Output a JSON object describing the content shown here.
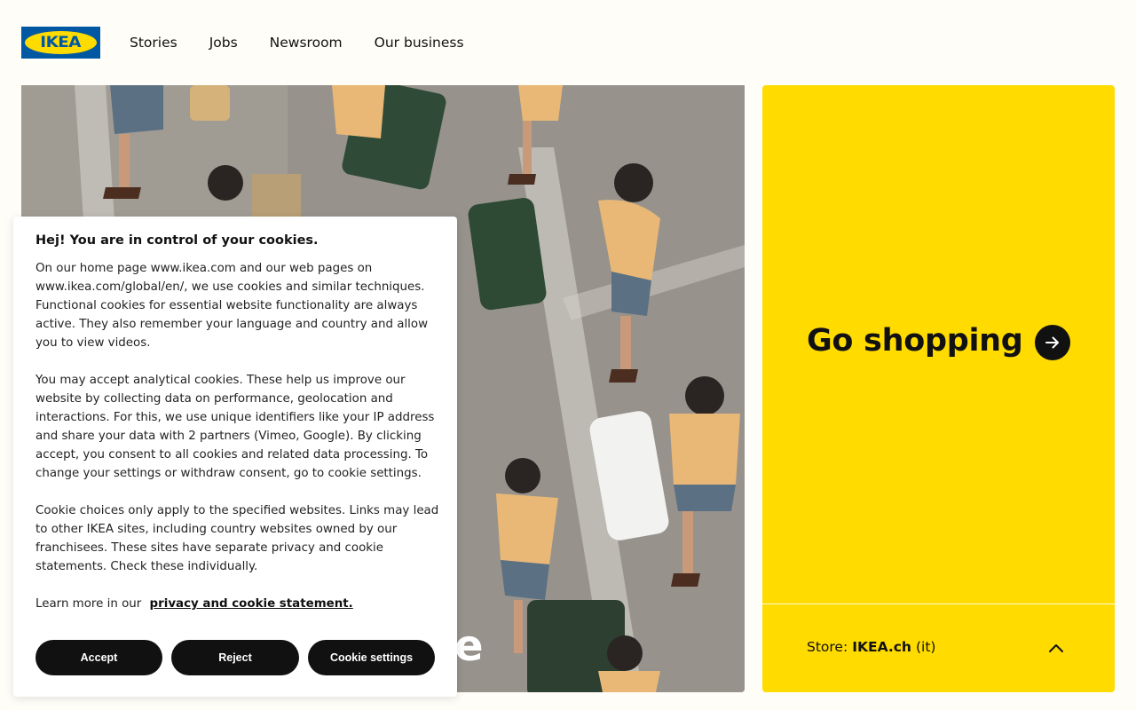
{
  "header": {
    "logo_text": "IKEA",
    "nav": [
      "Stories",
      "Jobs",
      "Newsroom",
      "Our business"
    ]
  },
  "hero": {
    "caption_fragment": "e"
  },
  "promo": {
    "title": "Go shopping",
    "arrow_icon": "arrow-right-icon",
    "store_label": "Store:",
    "store_name": "IKEA.ch",
    "store_lang": "(it)",
    "chevron_icon": "chevron-up-icon"
  },
  "cookie": {
    "title": "Hej! You are in control of your cookies.",
    "para1": "On our home page www.ikea.com and our web pages on www.ikea.com/global/en/, we use cookies and similar techniques. Functional cookies for essential website functionality are always active. They also remember your language and country and allow you to view videos.",
    "para2": "You may accept analytical cookies. These help us improve our website by collecting data on performance, geolocation and interactions. For this, we use unique identifiers like your IP address and share your data with 2 partners (Vimeo, Google). By clicking accept, you consent to all cookies and related data processing. To change your settings or withdraw consent, go to cookie settings.",
    "para3": "Cookie choices only apply to the specified websites. Links may lead to other IKEA sites, including country websites owned by our franchisees. These sites have separate privacy and cookie statements. Check these individually.",
    "learn_prefix": "Learn more in our",
    "learn_link": "privacy and cookie statement.",
    "accept": "Accept",
    "reject": "Reject",
    "settings": "Cookie settings"
  },
  "colors": {
    "brand_blue": "#0058a3",
    "brand_yellow": "#ffdb00",
    "button_dark": "#111111"
  }
}
